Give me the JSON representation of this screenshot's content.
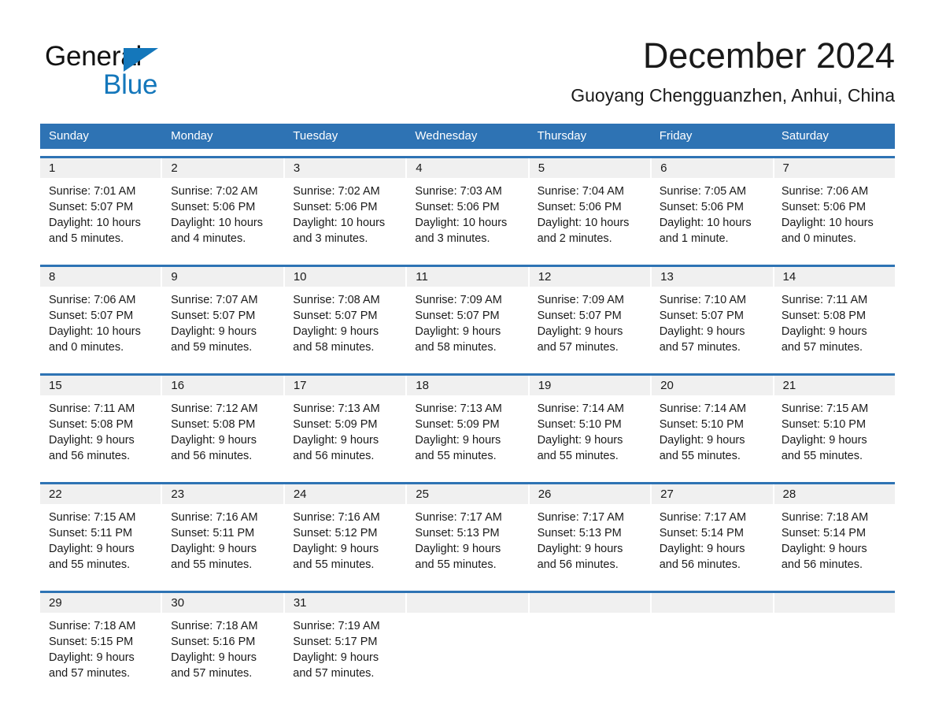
{
  "brand": {
    "name_part1": "General",
    "name_part2": "Blue",
    "logo_icon": "triangle-icon",
    "accent_color": "#1477bb"
  },
  "header": {
    "title": "December 2024",
    "subtitle": "Guoyang Chengguanzhen, Anhui, China"
  },
  "calendar": {
    "header_color": "#2e73b4",
    "daynum_band_color": "#f0f0f0",
    "weekdays": [
      "Sunday",
      "Monday",
      "Tuesday",
      "Wednesday",
      "Thursday",
      "Friday",
      "Saturday"
    ],
    "weeks": [
      [
        {
          "day": "1",
          "sunrise": "Sunrise: 7:01 AM",
          "sunset": "Sunset: 5:07 PM",
          "daylight_line1": "Daylight: 10 hours",
          "daylight_line2": "and 5 minutes."
        },
        {
          "day": "2",
          "sunrise": "Sunrise: 7:02 AM",
          "sunset": "Sunset: 5:06 PM",
          "daylight_line1": "Daylight: 10 hours",
          "daylight_line2": "and 4 minutes."
        },
        {
          "day": "3",
          "sunrise": "Sunrise: 7:02 AM",
          "sunset": "Sunset: 5:06 PM",
          "daylight_line1": "Daylight: 10 hours",
          "daylight_line2": "and 3 minutes."
        },
        {
          "day": "4",
          "sunrise": "Sunrise: 7:03 AM",
          "sunset": "Sunset: 5:06 PM",
          "daylight_line1": "Daylight: 10 hours",
          "daylight_line2": "and 3 minutes."
        },
        {
          "day": "5",
          "sunrise": "Sunrise: 7:04 AM",
          "sunset": "Sunset: 5:06 PM",
          "daylight_line1": "Daylight: 10 hours",
          "daylight_line2": "and 2 minutes."
        },
        {
          "day": "6",
          "sunrise": "Sunrise: 7:05 AM",
          "sunset": "Sunset: 5:06 PM",
          "daylight_line1": "Daylight: 10 hours",
          "daylight_line2": "and 1 minute."
        },
        {
          "day": "7",
          "sunrise": "Sunrise: 7:06 AM",
          "sunset": "Sunset: 5:06 PM",
          "daylight_line1": "Daylight: 10 hours",
          "daylight_line2": "and 0 minutes."
        }
      ],
      [
        {
          "day": "8",
          "sunrise": "Sunrise: 7:06 AM",
          "sunset": "Sunset: 5:07 PM",
          "daylight_line1": "Daylight: 10 hours",
          "daylight_line2": "and 0 minutes."
        },
        {
          "day": "9",
          "sunrise": "Sunrise: 7:07 AM",
          "sunset": "Sunset: 5:07 PM",
          "daylight_line1": "Daylight: 9 hours",
          "daylight_line2": "and 59 minutes."
        },
        {
          "day": "10",
          "sunrise": "Sunrise: 7:08 AM",
          "sunset": "Sunset: 5:07 PM",
          "daylight_line1": "Daylight: 9 hours",
          "daylight_line2": "and 58 minutes."
        },
        {
          "day": "11",
          "sunrise": "Sunrise: 7:09 AM",
          "sunset": "Sunset: 5:07 PM",
          "daylight_line1": "Daylight: 9 hours",
          "daylight_line2": "and 58 minutes."
        },
        {
          "day": "12",
          "sunrise": "Sunrise: 7:09 AM",
          "sunset": "Sunset: 5:07 PM",
          "daylight_line1": "Daylight: 9 hours",
          "daylight_line2": "and 57 minutes."
        },
        {
          "day": "13",
          "sunrise": "Sunrise: 7:10 AM",
          "sunset": "Sunset: 5:07 PM",
          "daylight_line1": "Daylight: 9 hours",
          "daylight_line2": "and 57 minutes."
        },
        {
          "day": "14",
          "sunrise": "Sunrise: 7:11 AM",
          "sunset": "Sunset: 5:08 PM",
          "daylight_line1": "Daylight: 9 hours",
          "daylight_line2": "and 57 minutes."
        }
      ],
      [
        {
          "day": "15",
          "sunrise": "Sunrise: 7:11 AM",
          "sunset": "Sunset: 5:08 PM",
          "daylight_line1": "Daylight: 9 hours",
          "daylight_line2": "and 56 minutes."
        },
        {
          "day": "16",
          "sunrise": "Sunrise: 7:12 AM",
          "sunset": "Sunset: 5:08 PM",
          "daylight_line1": "Daylight: 9 hours",
          "daylight_line2": "and 56 minutes."
        },
        {
          "day": "17",
          "sunrise": "Sunrise: 7:13 AM",
          "sunset": "Sunset: 5:09 PM",
          "daylight_line1": "Daylight: 9 hours",
          "daylight_line2": "and 56 minutes."
        },
        {
          "day": "18",
          "sunrise": "Sunrise: 7:13 AM",
          "sunset": "Sunset: 5:09 PM",
          "daylight_line1": "Daylight: 9 hours",
          "daylight_line2": "and 55 minutes."
        },
        {
          "day": "19",
          "sunrise": "Sunrise: 7:14 AM",
          "sunset": "Sunset: 5:10 PM",
          "daylight_line1": "Daylight: 9 hours",
          "daylight_line2": "and 55 minutes."
        },
        {
          "day": "20",
          "sunrise": "Sunrise: 7:14 AM",
          "sunset": "Sunset: 5:10 PM",
          "daylight_line1": "Daylight: 9 hours",
          "daylight_line2": "and 55 minutes."
        },
        {
          "day": "21",
          "sunrise": "Sunrise: 7:15 AM",
          "sunset": "Sunset: 5:10 PM",
          "daylight_line1": "Daylight: 9 hours",
          "daylight_line2": "and 55 minutes."
        }
      ],
      [
        {
          "day": "22",
          "sunrise": "Sunrise: 7:15 AM",
          "sunset": "Sunset: 5:11 PM",
          "daylight_line1": "Daylight: 9 hours",
          "daylight_line2": "and 55 minutes."
        },
        {
          "day": "23",
          "sunrise": "Sunrise: 7:16 AM",
          "sunset": "Sunset: 5:11 PM",
          "daylight_line1": "Daylight: 9 hours",
          "daylight_line2": "and 55 minutes."
        },
        {
          "day": "24",
          "sunrise": "Sunrise: 7:16 AM",
          "sunset": "Sunset: 5:12 PM",
          "daylight_line1": "Daylight: 9 hours",
          "daylight_line2": "and 55 minutes."
        },
        {
          "day": "25",
          "sunrise": "Sunrise: 7:17 AM",
          "sunset": "Sunset: 5:13 PM",
          "daylight_line1": "Daylight: 9 hours",
          "daylight_line2": "and 55 minutes."
        },
        {
          "day": "26",
          "sunrise": "Sunrise: 7:17 AM",
          "sunset": "Sunset: 5:13 PM",
          "daylight_line1": "Daylight: 9 hours",
          "daylight_line2": "and 56 minutes."
        },
        {
          "day": "27",
          "sunrise": "Sunrise: 7:17 AM",
          "sunset": "Sunset: 5:14 PM",
          "daylight_line1": "Daylight: 9 hours",
          "daylight_line2": "and 56 minutes."
        },
        {
          "day": "28",
          "sunrise": "Sunrise: 7:18 AM",
          "sunset": "Sunset: 5:14 PM",
          "daylight_line1": "Daylight: 9 hours",
          "daylight_line2": "and 56 minutes."
        }
      ],
      [
        {
          "day": "29",
          "sunrise": "Sunrise: 7:18 AM",
          "sunset": "Sunset: 5:15 PM",
          "daylight_line1": "Daylight: 9 hours",
          "daylight_line2": "and 57 minutes."
        },
        {
          "day": "30",
          "sunrise": "Sunrise: 7:18 AM",
          "sunset": "Sunset: 5:16 PM",
          "daylight_line1": "Daylight: 9 hours",
          "daylight_line2": "and 57 minutes."
        },
        {
          "day": "31",
          "sunrise": "Sunrise: 7:19 AM",
          "sunset": "Sunset: 5:17 PM",
          "daylight_line1": "Daylight: 9 hours",
          "daylight_line2": "and 57 minutes."
        },
        {
          "day": "",
          "sunrise": "",
          "sunset": "",
          "daylight_line1": "",
          "daylight_line2": ""
        },
        {
          "day": "",
          "sunrise": "",
          "sunset": "",
          "daylight_line1": "",
          "daylight_line2": ""
        },
        {
          "day": "",
          "sunrise": "",
          "sunset": "",
          "daylight_line1": "",
          "daylight_line2": ""
        },
        {
          "day": "",
          "sunrise": "",
          "sunset": "",
          "daylight_line1": "",
          "daylight_line2": ""
        }
      ]
    ]
  }
}
